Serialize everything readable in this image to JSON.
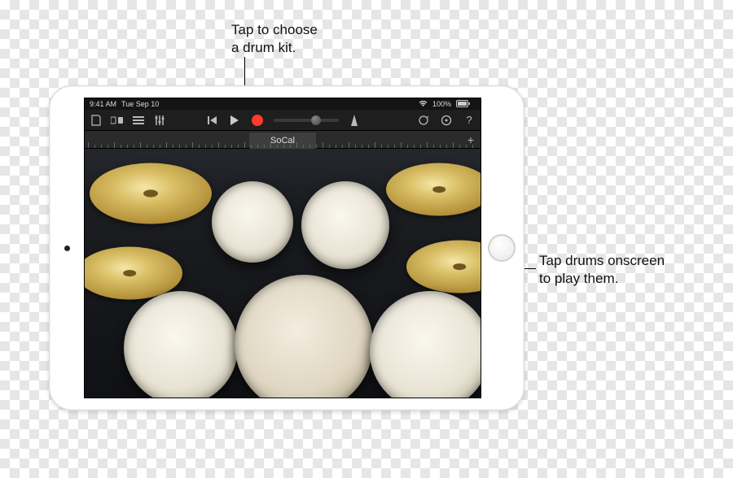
{
  "callouts": {
    "kit": "Tap to choose\na drum kit.",
    "play": "Tap drums onscreen\nto play them."
  },
  "statusbar": {
    "time": "9:41 AM",
    "date": "Tue Sep 10",
    "battery": "100%"
  },
  "toolbar": {
    "icons": {
      "my_songs": "my-songs",
      "browser": "browser",
      "tracks": "tracks",
      "fx": "fx",
      "rewind": "rewind",
      "play": "play",
      "record": "record",
      "metronome": "metronome",
      "loop": "loop",
      "settings": "settings",
      "help": "help"
    }
  },
  "ruler": {
    "kit_name": "SoCal",
    "plus": "+"
  },
  "drums": {
    "crash_left": "crash-cymbal-left",
    "crash_right": "crash-cymbal-right",
    "hihat": "hi-hat",
    "ride": "ride-cymbal",
    "tom_high": "high-tom",
    "tom_mid": "mid-tom",
    "snare": "snare-drum",
    "kick": "kick-drum",
    "floor_tom": "floor-tom"
  }
}
